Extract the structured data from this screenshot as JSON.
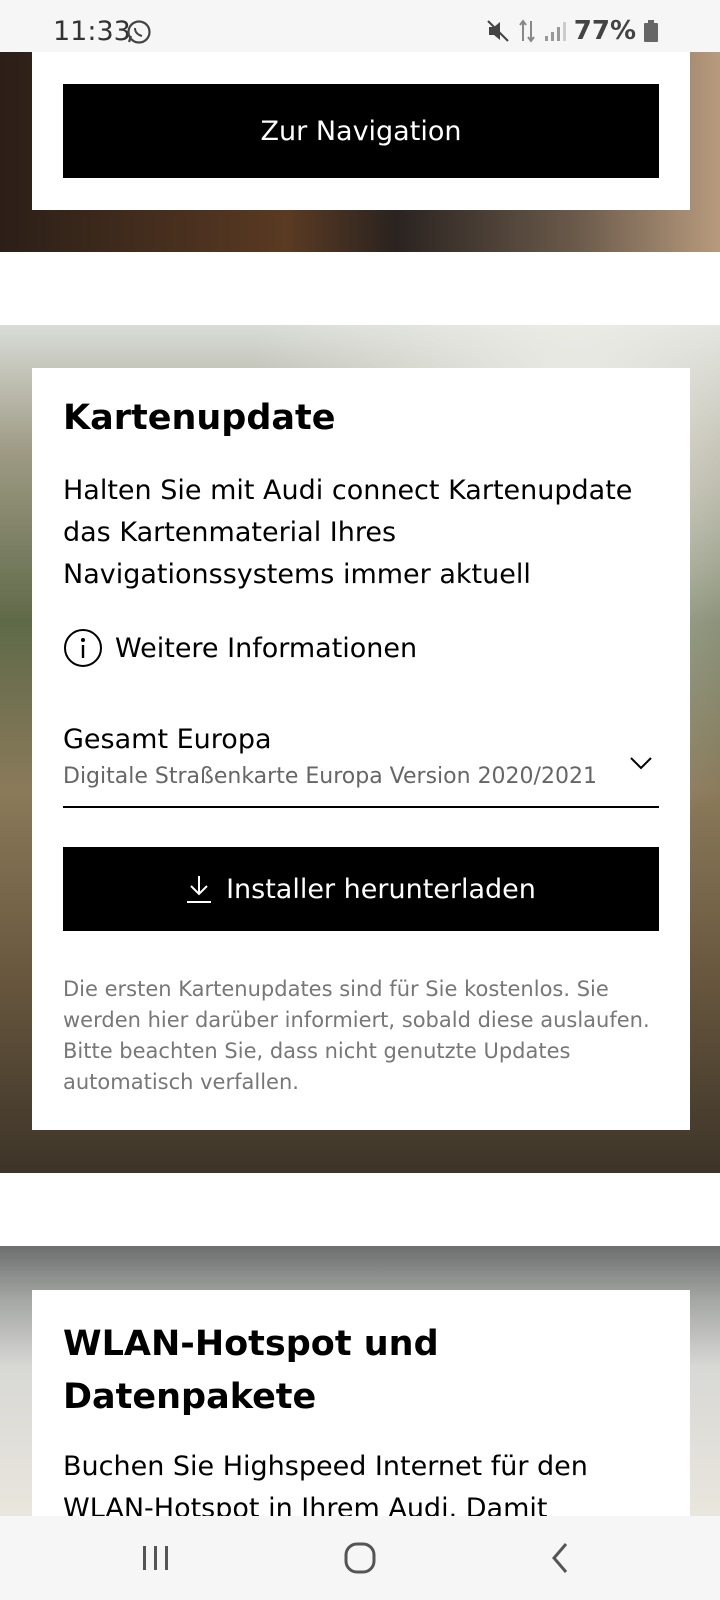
{
  "status_bar": {
    "time": "11:33",
    "battery": "77%",
    "icons": [
      "whatsapp-icon",
      "mute-icon",
      "data-arrows-icon",
      "signal-icon",
      "battery-icon"
    ]
  },
  "navigation_section": {
    "button_label": "Zur Navigation"
  },
  "map_update": {
    "title": "Kartenupdate",
    "description": "Halten Sie mit Audi connect Kartenupdate das Kartenmaterial Ihres Navigationssystems immer aktuell",
    "info_link": "Weitere Informationen",
    "select": {
      "value": "Gesamt Europa",
      "subtext": "Digitale Straßenkarte Europa Version 2020/2021"
    },
    "download_button": "Installer herunterladen",
    "fine_print": "Die ersten Kartenupdates sind für Sie kostenlos. Sie werden hier darüber informiert, sobald diese auslaufen. Bitte beachten Sie, dass nicht genutzte Updates automatisch verfallen."
  },
  "wlan_section": {
    "title": "WLAN-Hotspot und Datenpakete",
    "description": "Buchen Sie Highspeed Internet für den WLAN-Hotspot in Ihrem Audi. Damit"
  },
  "system_nav": {
    "icons": [
      "recents-icon",
      "home-icon",
      "back-icon"
    ]
  }
}
